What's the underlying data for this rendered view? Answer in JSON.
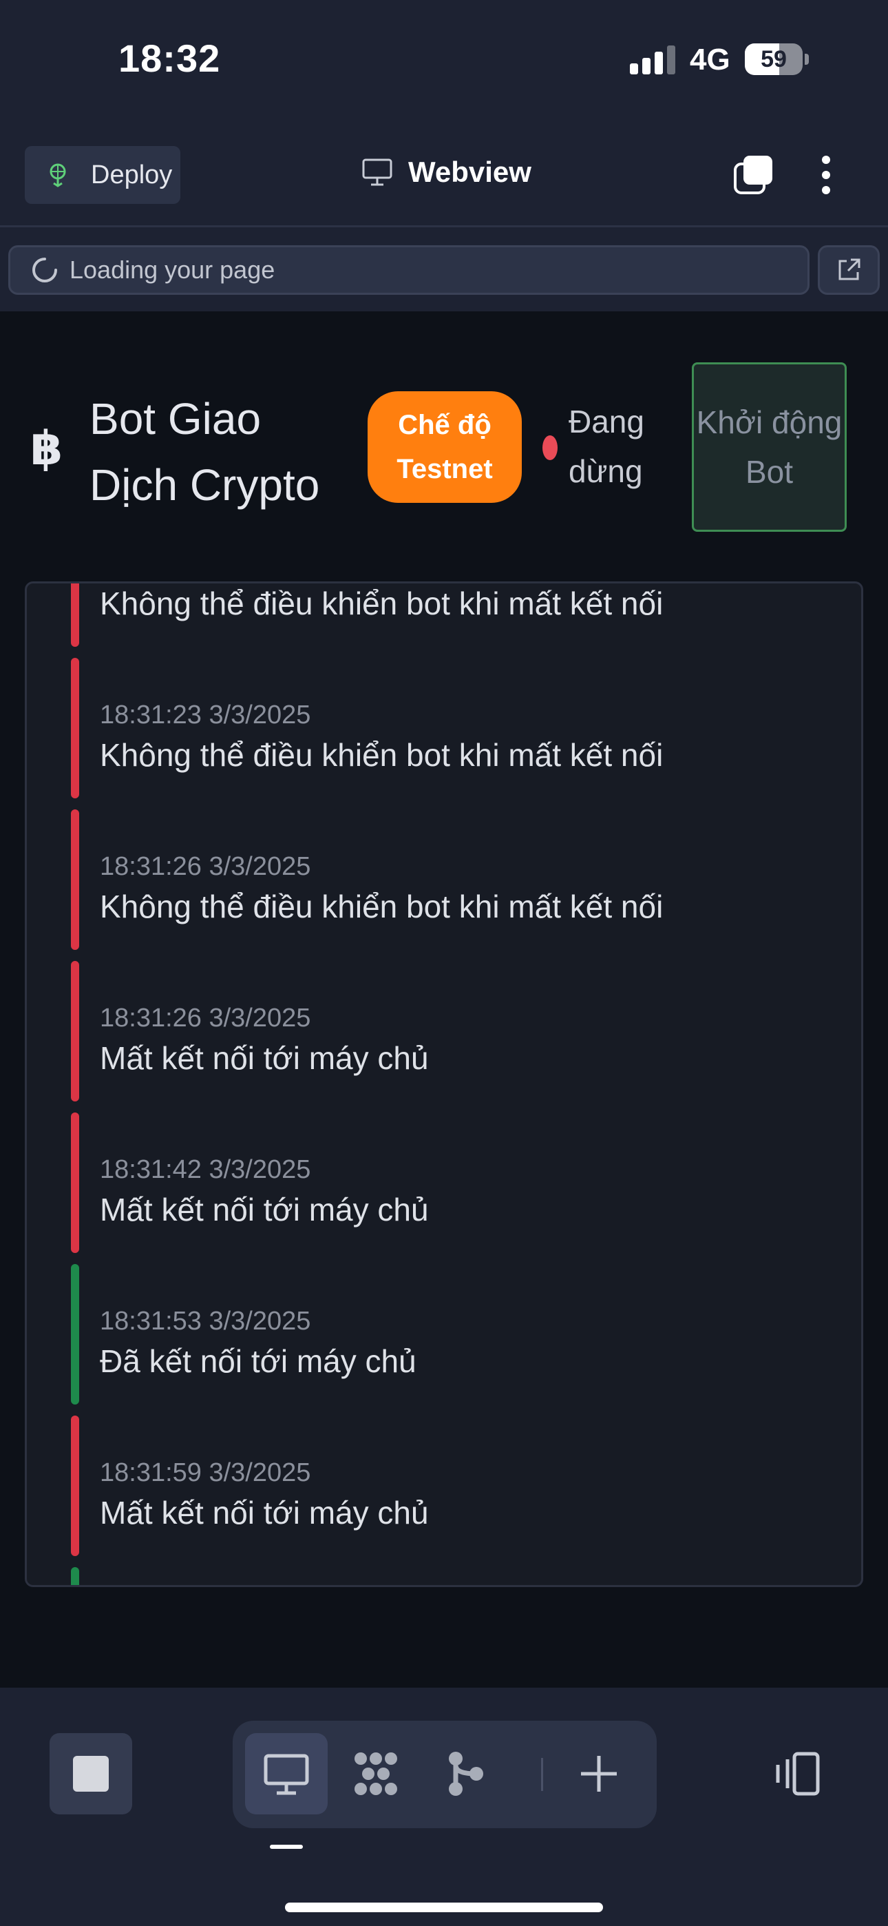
{
  "status_bar": {
    "time": "18:32",
    "network": "4G",
    "battery": "59",
    "battery_level": 0.59
  },
  "toolbar": {
    "deploy_label": "Deploy",
    "title": "Webview"
  },
  "urlbar": {
    "text": "Loading your page"
  },
  "app": {
    "title": "Bot Giao Dịch Crypto",
    "mode_badge": "Chế độ Testnet",
    "status": "Đang dừng",
    "start_button": "Khởi động Bot"
  },
  "logs": [
    {
      "time": "",
      "message": "Không thể điều khiển bot khi mất kết nối",
      "level": "error"
    },
    {
      "time": "18:31:23 3/3/2025",
      "message": "Không thể điều khiển bot khi mất kết nối",
      "level": "error"
    },
    {
      "time": "18:31:26 3/3/2025",
      "message": "Không thể điều khiển bot khi mất kết nối",
      "level": "error"
    },
    {
      "time": "18:31:26 3/3/2025",
      "message": "Mất kết nối tới máy chủ",
      "level": "error"
    },
    {
      "time": "18:31:42 3/3/2025",
      "message": "Mất kết nối tới máy chủ",
      "level": "error"
    },
    {
      "time": "18:31:53 3/3/2025",
      "message": "Đã kết nối tới máy chủ",
      "level": "success"
    },
    {
      "time": "18:31:59 3/3/2025",
      "message": "Mất kết nối tới máy chủ",
      "level": "error"
    },
    {
      "time": "",
      "message": "",
      "level": "success"
    }
  ],
  "colors": {
    "accent_orange": "#ff7f0f",
    "error": "#dc3545",
    "success": "#1e8a4c",
    "start_border": "#3e8d53"
  }
}
